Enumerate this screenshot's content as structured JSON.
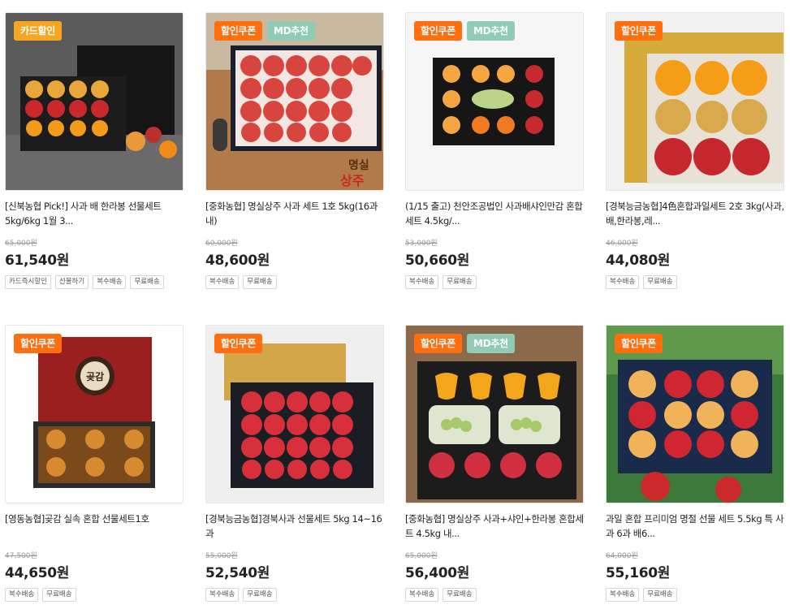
{
  "products": [
    {
      "badges": [
        {
          "label": "카드할인",
          "type": "card-sale"
        }
      ],
      "title": "[신북농협 Pick!] 사과 배 한라봉 선물세트 5kg/6kg 1월 3...",
      "original_price": "65,000원",
      "price": "61,540원",
      "tags": [
        "카드즉시할인",
        "선물하기",
        "복수배송",
        "무료배송"
      ],
      "image_desc": "apple-pear-hallabong-gift-box"
    },
    {
      "badges": [
        {
          "label": "할인쿠폰",
          "type": "coupon"
        },
        {
          "label": "MD추천",
          "type": "md"
        }
      ],
      "title": "[중화농협] 명실상주 사과 세트 1호 5kg(16과내)",
      "original_price": "60,000원",
      "price": "48,600원",
      "tags": [
        "복수배송",
        "무료배송"
      ],
      "image_desc": "sangju-apple-box",
      "image_text": [
        "명실",
        "상주"
      ]
    },
    {
      "badges": [
        {
          "label": "할인쿠폰",
          "type": "coupon"
        },
        {
          "label": "MD추천",
          "type": "md"
        }
      ],
      "title": "(1/15 출고) 천안조공법인 사과배샤인만감 혼합세트 4.5kg/...",
      "original_price": "53,000원",
      "price": "50,660원",
      "tags": [
        "복수배송",
        "무료배송"
      ],
      "image_desc": "mixed-fruit-box"
    },
    {
      "badges": [
        {
          "label": "할인쿠폰",
          "type": "coupon"
        }
      ],
      "title": "[경북능금농협]4色혼합과일세트 2호 3kg(사과,배,한라봉,레...",
      "original_price": "46,000원",
      "price": "44,080원",
      "tags": [
        "복수배송",
        "무료배송"
      ],
      "image_desc": "four-color-fruit-set"
    },
    {
      "badges": [
        {
          "label": "할인쿠폰",
          "type": "coupon"
        }
      ],
      "title": "[영동농협]곶감 실속 혼합 선물세트1호",
      "original_price": "47,500원",
      "price": "44,650원",
      "tags": [
        "복수배송",
        "무료배송"
      ],
      "image_desc": "dried-persimmon-box",
      "image_text": [
        "곶감"
      ]
    },
    {
      "badges": [
        {
          "label": "할인쿠폰",
          "type": "coupon"
        }
      ],
      "title": "[경북능금농협]경북사과 선물세트 5kg 14~16과",
      "original_price": "55,000원",
      "price": "52,540원",
      "tags": [
        "복수배송",
        "무료배송"
      ],
      "image_desc": "gyeongbuk-apple-box"
    },
    {
      "badges": [
        {
          "label": "할인쿠폰",
          "type": "coupon"
        },
        {
          "label": "MD추천",
          "type": "md"
        }
      ],
      "title": "[중화농협] 명실상주 사과+샤인+한라봉 혼합세트 4.5kg 내...",
      "original_price": "65,000원",
      "price": "56,400원",
      "tags": [
        "복수배송",
        "무료배송"
      ],
      "image_desc": "apple-shine-hallabong-box"
    },
    {
      "badges": [
        {
          "label": "할인쿠폰",
          "type": "coupon"
        }
      ],
      "title": "과일 혼합 프리미엄 명절 선물 세트 5.5kg 특 사과 6과 배6...",
      "original_price": "64,000원",
      "price": "55,160원",
      "tags": [
        "복수배송",
        "무료배송"
      ],
      "image_desc": "premium-mixed-fruit-box"
    }
  ],
  "colors": {
    "coupon": "#ff6f0f",
    "md": "#8fcbb5",
    "card_sale": "#f5a623"
  }
}
